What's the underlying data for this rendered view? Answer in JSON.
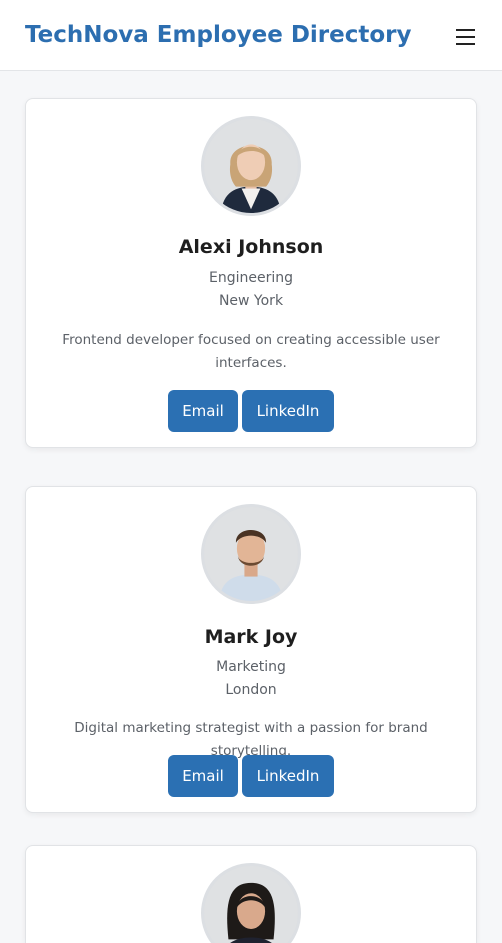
{
  "header": {
    "title": "TechNova Employee Directory",
    "menu_icon": "hamburger-menu-icon"
  },
  "employees": [
    {
      "name": "Alexi Johnson",
      "department": "Engineering",
      "location": "New York",
      "bio": "Frontend developer focused on creating accessible user interfaces.",
      "email_label": "Email",
      "linkedin_label": "LinkedIn"
    },
    {
      "name": "Mark Joy",
      "department": "Marketing",
      "location": "London",
      "bio": "Digital marketing strategist with a passion for brand storytelling.",
      "email_label": "Email",
      "linkedin_label": "LinkedIn"
    },
    {
      "name": "",
      "department": "",
      "location": "",
      "bio": "",
      "email_label": "",
      "linkedin_label": ""
    }
  ],
  "colors": {
    "accent": "#2c6eb0",
    "button": "#2b70b3",
    "background": "#f6f7f9"
  }
}
